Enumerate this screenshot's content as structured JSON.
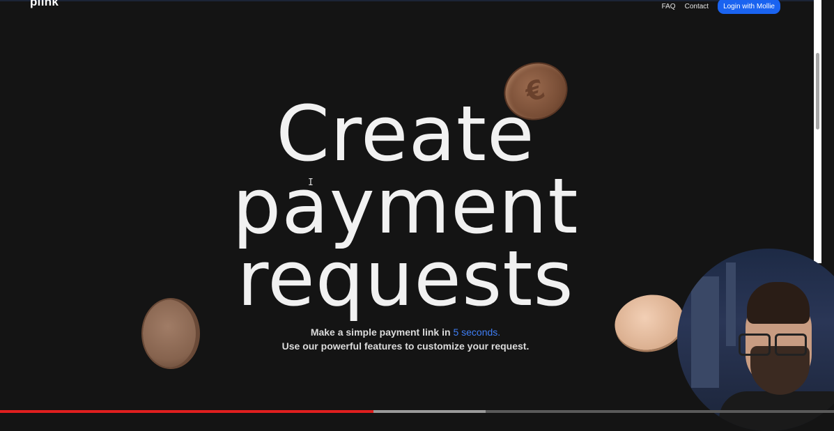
{
  "header": {
    "logo": "plink",
    "nav": {
      "faq": "FAQ",
      "contact": "Contact",
      "login": "Login with Mollie"
    }
  },
  "hero": {
    "lines": [
      "Create",
      "payment",
      "requests"
    ],
    "subtitle_part1": "Make a simple payment link in ",
    "subtitle_accent": "5 seconds.",
    "subtitle_line2": "Use our powerful features to customize your request."
  },
  "coin_symbol": "€",
  "cursor_glyph": "I",
  "colors": {
    "accent": "#3f7ef5",
    "button": "#1a63f0",
    "progress": "#e01f1f",
    "background": "#141414"
  },
  "video": {
    "played_fraction": 0.448,
    "buffered_fraction": 0.582
  }
}
